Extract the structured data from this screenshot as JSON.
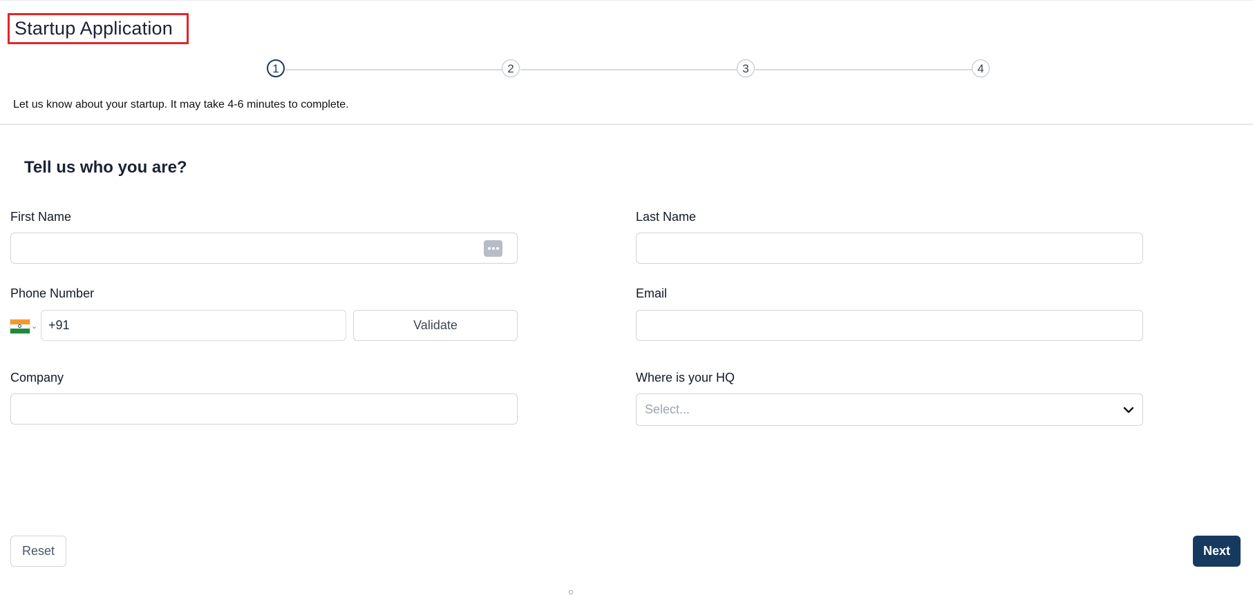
{
  "header": {
    "title": "Startup Application",
    "intro": "Let us know about your startup. It may take 4-6 minutes to complete."
  },
  "stepper": {
    "steps": [
      "1",
      "2",
      "3",
      "4"
    ],
    "current": 1
  },
  "form": {
    "section_title": "Tell us who you are?",
    "first_name": {
      "label": "First Name",
      "value": ""
    },
    "last_name": {
      "label": "Last Name",
      "value": ""
    },
    "phone": {
      "label": "Phone Number",
      "country_code": "+91",
      "country_icon": "india-flag-icon",
      "validate_label": "Validate"
    },
    "email": {
      "label": "Email",
      "value": ""
    },
    "company": {
      "label": "Company",
      "value": ""
    },
    "hq": {
      "label": "Where is your HQ",
      "placeholder": "Select..."
    }
  },
  "actions": {
    "reset_label": "Reset",
    "next_label": "Next"
  },
  "colors": {
    "accent": "#163a5f",
    "highlight_border": "#e0262a"
  }
}
